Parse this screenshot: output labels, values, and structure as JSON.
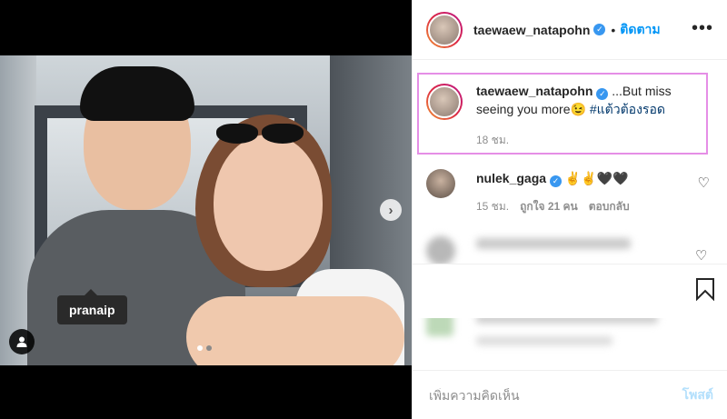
{
  "media": {
    "tagged_user": "pranaip",
    "carousel": {
      "current": 1,
      "total": 2
    },
    "icons": {
      "next": "chevron-right-icon",
      "tags": "user-icon"
    }
  },
  "header": {
    "username": "taewaew_natapohn",
    "bullet": "•",
    "follow_label": "ติดตาม",
    "more_label": "•••"
  },
  "caption": {
    "username": "taewaew_natapohn",
    "text": " ...But miss seeing you more😉 ",
    "hashtag": "#แต้วต้องรอด",
    "time": "18 ชม."
  },
  "comments": [
    {
      "username": "nulek_gaga",
      "text": "✌✌🖤🖤",
      "time": "15 ชม.",
      "likes": "ถูกใจ 21 คน",
      "reply": "ตอบกลับ"
    }
  ],
  "composer": {
    "placeholder": "เพิ่มความคิดเห็น",
    "post_label": "โพสต์"
  },
  "colors": {
    "accent": "#0095f6",
    "highlight_border": "#e58ee6",
    "verified": "#3897f0"
  }
}
